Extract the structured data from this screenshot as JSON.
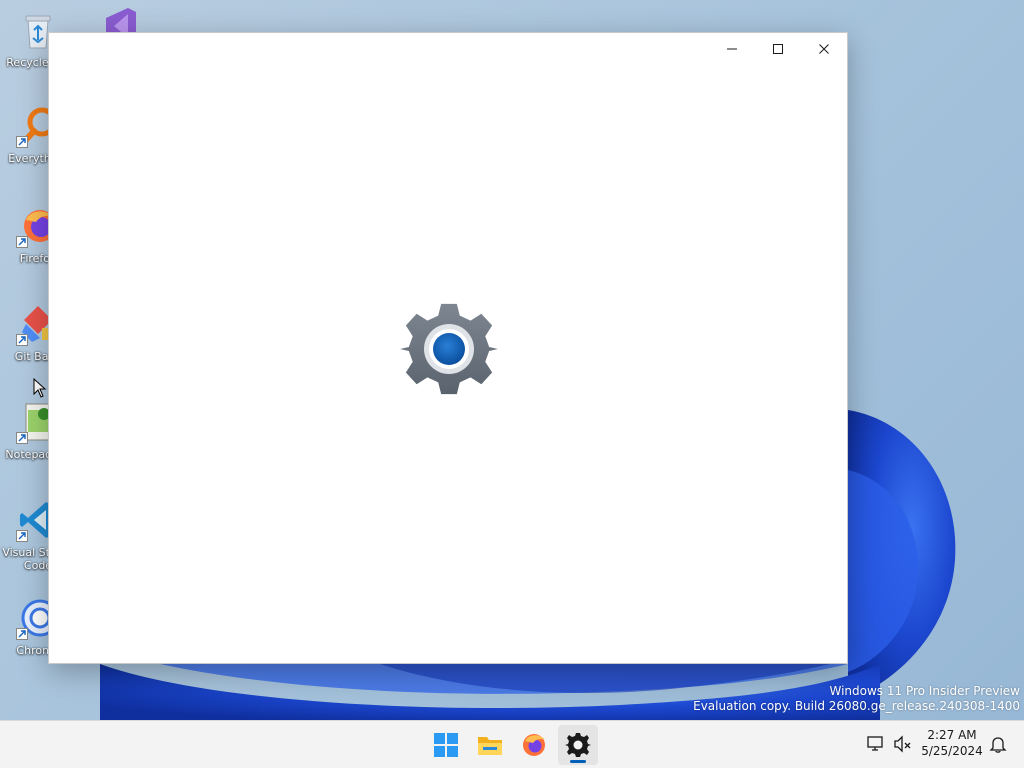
{
  "desktop": {
    "icons": [
      {
        "label": "Recycle Bin",
        "icon": "recycle-bin-icon"
      },
      {
        "label": "Everything",
        "icon": "everything-icon"
      },
      {
        "label": "Firefox",
        "icon": "firefox-icon"
      },
      {
        "label": "Git Bash",
        "icon": "git-bash-icon"
      },
      {
        "label": "Notepad++",
        "icon": "notepad-plus-plus-icon"
      },
      {
        "label": "Visual Studio Code",
        "icon": "vscode-icon"
      },
      {
        "label": "Chrome",
        "icon": "chrome-icon"
      },
      {
        "label": "",
        "icon": "visual-studio-icon"
      }
    ],
    "watermark": {
      "line1": "Windows 11 Pro Insider Preview",
      "line2": "Evaluation copy. Build 26080.ge_release.240308-1400"
    }
  },
  "window": {
    "app": "Settings",
    "splash_icon": "settings-gear-icon",
    "caption_buttons": [
      "minimize-icon",
      "maximize-icon",
      "close-icon"
    ]
  },
  "taskbar": {
    "apps": [
      {
        "icon": "start-icon",
        "active": false
      },
      {
        "icon": "file-explorer-icon",
        "active": false
      },
      {
        "icon": "firefox-icon",
        "active": false
      },
      {
        "icon": "settings-gear-icon",
        "active": true
      }
    ],
    "tray": {
      "icons": [
        "network-icon",
        "volume-muted-icon",
        "notification-bell-icon"
      ],
      "time": "2:27 AM",
      "date": "5/25/2024"
    }
  },
  "colors": {
    "accent": "#005fb8",
    "bloom_blue": "#1f4fd6",
    "taskbar_bg": "#f3f3f3",
    "window_bg": "#ffffff"
  }
}
